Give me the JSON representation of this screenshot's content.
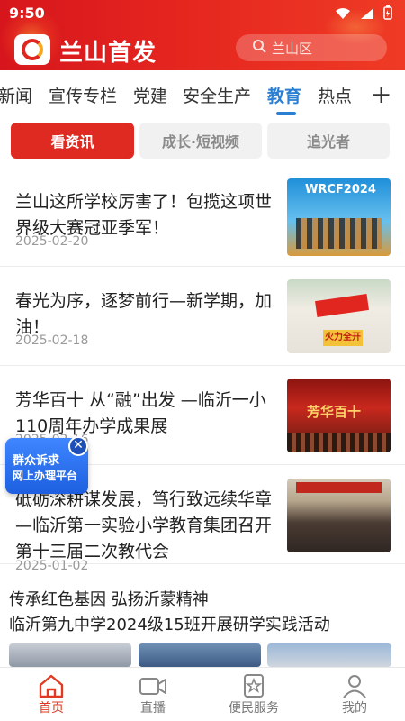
{
  "status": {
    "time": "9:50"
  },
  "header": {
    "title": "兰山首发",
    "search_placeholder": "兰山区"
  },
  "nav": {
    "tabs": [
      "新闻",
      "宣传专栏",
      "党建",
      "安全生产",
      "教育",
      "热点"
    ],
    "active": "教育"
  },
  "subtabs": [
    "看资讯",
    "成长·短视频",
    "追光者"
  ],
  "news": [
    {
      "title": "兰山这所学校厉害了！包揽这项世界级大赛冠亚季军！",
      "date": "2025-02-20",
      "thumb_text": "WRCF2024"
    },
    {
      "title": "春光为序，逐梦前行—新学期，加油！",
      "date": "2025-02-18",
      "thumb_text": "火力全开"
    },
    {
      "title": "芳华百十  从“融”出发  —临沂一小110周年办学成果展",
      "date": "2025-02-16",
      "thumb_text": "芳华百十"
    },
    {
      "title": "砥砺深耕谋发展，笃行致远续华章—临沂第一实验小学教育集团召开第十三届二次教代会",
      "date": "2025-01-02"
    }
  ],
  "feature": {
    "title": "传承红色基因  弘扬沂蒙精神\n临沂第九中学2024级15班开展研学实践活动"
  },
  "floating": {
    "line1": "群众诉求",
    "line2": "网上办理平台"
  },
  "bottom_nav": [
    {
      "label": "首页",
      "icon": "home-icon"
    },
    {
      "label": "直播",
      "icon": "video-icon"
    },
    {
      "label": "便民服务",
      "icon": "service-icon"
    },
    {
      "label": "我的",
      "icon": "user-icon"
    }
  ],
  "colors": {
    "brand_red": "#e0261f",
    "active_blue": "#2b7fd3",
    "widget_blue": "#1d5fe0"
  }
}
